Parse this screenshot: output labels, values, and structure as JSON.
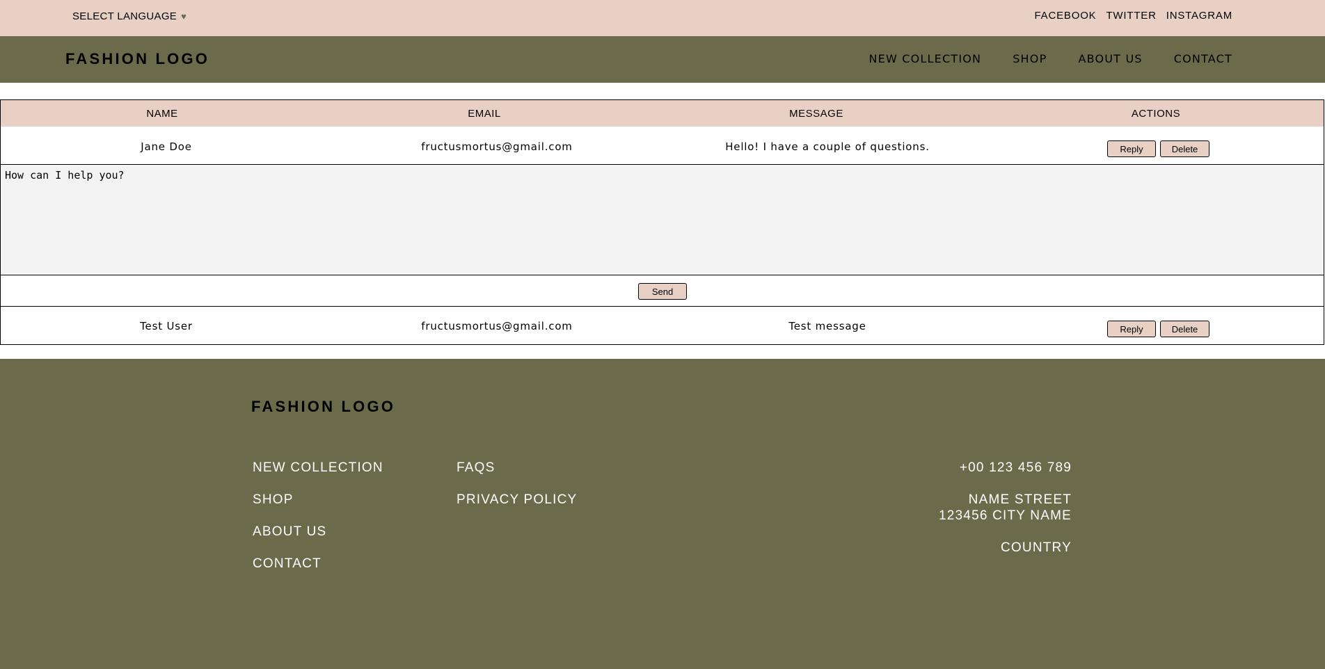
{
  "topbar": {
    "language_label": "SELECT LANGUAGE",
    "language_icon": "heart-icon",
    "social": [
      "FACEBOOK",
      "TWITTER",
      "INSTAGRAM"
    ]
  },
  "header": {
    "logo": "FASHION LOGO",
    "nav": [
      "NEW COLLECTION",
      "SHOP",
      "ABOUT US",
      "CONTACT"
    ]
  },
  "table": {
    "columns": [
      "NAME",
      "EMAIL",
      "MESSAGE",
      "ACTIONS"
    ],
    "rows": [
      {
        "name": "Jane Doe",
        "email": "fructusmortus@gmail.com",
        "message": "Hello! I have a couple of questions.",
        "reply_label": "Reply",
        "delete_label": "Delete"
      },
      {
        "name": "Test User",
        "email": "fructusmortus@gmail.com",
        "message": "Test message",
        "reply_label": "Reply",
        "delete_label": "Delete"
      }
    ],
    "reply_text": "How can I help you?",
    "send_label": "Send"
  },
  "footer": {
    "logo": "FASHION LOGO",
    "col1": [
      "NEW COLLECTION",
      "SHOP",
      "ABOUT US",
      "CONTACT"
    ],
    "col2": [
      "FAQS",
      "PRIVACY POLICY"
    ],
    "phone": "+00 123 456 789",
    "street": "NAME STREET",
    "city": "123456 CITY NAME",
    "country": "COUNTRY"
  },
  "colors": {
    "accent_pink": "#e8d0c4",
    "olive": "#6b6b4c",
    "reply_bg": "#f3f3f3"
  }
}
